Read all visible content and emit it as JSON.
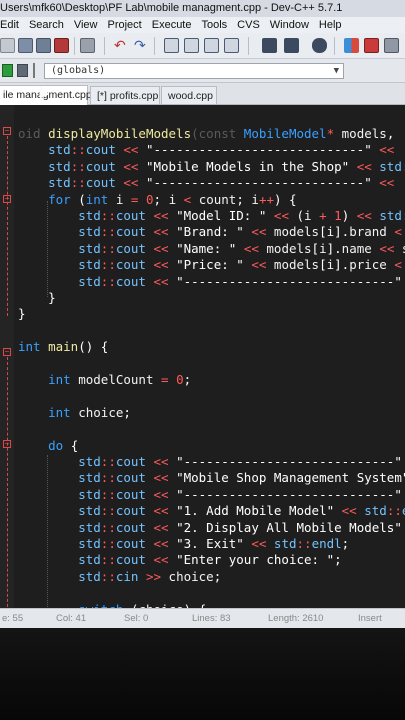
{
  "window": {
    "title": "Users\\mfk60\\Desktop\\PF Lab\\mobile managment.cpp - Dev-C++ 5.7.1"
  },
  "menu": [
    "Edit",
    "Search",
    "View",
    "Project",
    "Execute",
    "Tools",
    "CVS",
    "Window",
    "Help"
  ],
  "toolbar": {
    "icons": [
      "open-icon",
      "save-icon",
      "save-all-icon",
      "close-icon",
      "print-icon",
      "undo-icon",
      "redo-icon",
      "find-icon",
      "replace-icon",
      "find-next-icon",
      "goto-icon",
      "indent-icon",
      "unindent-icon",
      "toggle-comment-icon",
      "grid-icon",
      "window-icon",
      "window-icon-2",
      "window-icon-3"
    ]
  },
  "globals_bar": {
    "value": "(globals)"
  },
  "tabs": [
    {
      "label": "ile managment.cpp",
      "active": true
    },
    {
      "label": "[*] profits.cpp",
      "active": false
    },
    {
      "label": "wood.cpp",
      "active": false
    }
  ],
  "code": {
    "lines": [
      [
        [
          "dim",
          "oid "
        ],
        [
          "fn",
          "displayMobileModels"
        ],
        [
          "dim",
          "("
        ],
        [
          "dim",
          "const "
        ],
        [
          "ty",
          "MobileModel"
        ],
        [
          "op",
          "* "
        ],
        [
          "id",
          "models"
        ],
        [
          "punc",
          ", "
        ]
      ],
      [
        [
          "ns",
          "    std"
        ],
        [
          "op",
          "::"
        ],
        [
          "ns",
          "cout "
        ],
        [
          "op",
          "<< "
        ],
        [
          "str",
          "\"----------------------------\" "
        ],
        [
          "op",
          "<<"
        ]
      ],
      [
        [
          "ns",
          "    std"
        ],
        [
          "op",
          "::"
        ],
        [
          "ns",
          "cout "
        ],
        [
          "op",
          "<< "
        ],
        [
          "str",
          "\"Mobile Models in the Shop\" "
        ],
        [
          "op",
          "<< "
        ],
        [
          "ns",
          "std"
        ],
        [
          "op",
          ":"
        ]
      ],
      [
        [
          "ns",
          "    std"
        ],
        [
          "op",
          "::"
        ],
        [
          "ns",
          "cout "
        ],
        [
          "op",
          "<< "
        ],
        [
          "str",
          "\"----------------------------\" "
        ],
        [
          "op",
          "<<"
        ]
      ],
      [
        [
          "kw",
          "    for "
        ],
        [
          "punc",
          "("
        ],
        [
          "kw",
          "int "
        ],
        [
          "id",
          "i "
        ],
        [
          "op",
          "= "
        ],
        [
          "num",
          "0"
        ],
        [
          "punc",
          "; "
        ],
        [
          "id",
          "i "
        ],
        [
          "op",
          "< "
        ],
        [
          "id",
          "count"
        ],
        [
          "punc",
          "; "
        ],
        [
          "id",
          "i"
        ],
        [
          "op",
          "++"
        ],
        [
          "punc",
          ") {"
        ]
      ],
      [
        [
          "ns",
          "        std"
        ],
        [
          "op",
          "::"
        ],
        [
          "ns",
          "cout "
        ],
        [
          "op",
          "<< "
        ],
        [
          "str",
          "\"Model ID: \" "
        ],
        [
          "op",
          "<< "
        ],
        [
          "punc",
          "("
        ],
        [
          "id",
          "i "
        ],
        [
          "op",
          "+ "
        ],
        [
          "num",
          "1"
        ],
        [
          "punc",
          ") "
        ],
        [
          "op",
          "<< "
        ],
        [
          "ns",
          "std"
        ],
        [
          "op",
          ":"
        ]
      ],
      [
        [
          "ns",
          "        std"
        ],
        [
          "op",
          "::"
        ],
        [
          "ns",
          "cout "
        ],
        [
          "op",
          "<< "
        ],
        [
          "str",
          "\"Brand: \" "
        ],
        [
          "op",
          "<< "
        ],
        [
          "id",
          "models"
        ],
        [
          "punc",
          "["
        ],
        [
          "id",
          "i"
        ],
        [
          "punc",
          "]"
        ],
        [
          "punc",
          "."
        ],
        [
          "id",
          "brand "
        ],
        [
          "op",
          "<"
        ]
      ],
      [
        [
          "ns",
          "        std"
        ],
        [
          "op",
          "::"
        ],
        [
          "ns",
          "cout "
        ],
        [
          "op",
          "<< "
        ],
        [
          "str",
          "\"Name: \" "
        ],
        [
          "op",
          "<< "
        ],
        [
          "id",
          "models"
        ],
        [
          "punc",
          "["
        ],
        [
          "id",
          "i"
        ],
        [
          "punc",
          "]"
        ],
        [
          "punc",
          "."
        ],
        [
          "id",
          "name "
        ],
        [
          "op",
          "<< "
        ],
        [
          "id",
          "s"
        ]
      ],
      [
        [
          "ns",
          "        std"
        ],
        [
          "op",
          "::"
        ],
        [
          "ns",
          "cout "
        ],
        [
          "op",
          "<< "
        ],
        [
          "str",
          "\"Price: \" "
        ],
        [
          "op",
          "<< "
        ],
        [
          "id",
          "models"
        ],
        [
          "punc",
          "["
        ],
        [
          "id",
          "i"
        ],
        [
          "punc",
          "]"
        ],
        [
          "punc",
          "."
        ],
        [
          "id",
          "price "
        ],
        [
          "op",
          "<"
        ]
      ],
      [
        [
          "ns",
          "        std"
        ],
        [
          "op",
          "::"
        ],
        [
          "ns",
          "cout "
        ],
        [
          "op",
          "<< "
        ],
        [
          "str",
          "\"----------------------------\""
        ]
      ],
      [
        [
          "punc",
          "    }"
        ]
      ],
      [
        [
          "punc",
          "}"
        ]
      ],
      [],
      [
        [
          "kw",
          "int "
        ],
        [
          "fn",
          "main"
        ],
        [
          "punc",
          "() {"
        ]
      ],
      [],
      [
        [
          "kw",
          "    int "
        ],
        [
          "id",
          "modelCount "
        ],
        [
          "op",
          "= "
        ],
        [
          "num",
          "0"
        ],
        [
          "punc",
          ";"
        ]
      ],
      [],
      [
        [
          "kw",
          "    int "
        ],
        [
          "id",
          "choice"
        ],
        [
          "punc",
          ";"
        ]
      ],
      [],
      [
        [
          "kw",
          "    do "
        ],
        [
          "punc",
          "{"
        ]
      ],
      [
        [
          "ns",
          "        std"
        ],
        [
          "op",
          "::"
        ],
        [
          "ns",
          "cout "
        ],
        [
          "op",
          "<< "
        ],
        [
          "str",
          "\"----------------------------\" "
        ],
        [
          "op",
          "<"
        ]
      ],
      [
        [
          "ns",
          "        std"
        ],
        [
          "op",
          "::"
        ],
        [
          "ns",
          "cout "
        ],
        [
          "op",
          "<< "
        ],
        [
          "str",
          "\"Mobile Shop Management System\" "
        ],
        [
          "op",
          "<"
        ]
      ],
      [
        [
          "ns",
          "        std"
        ],
        [
          "op",
          "::"
        ],
        [
          "ns",
          "cout "
        ],
        [
          "op",
          "<< "
        ],
        [
          "str",
          "\"----------------------------\" "
        ],
        [
          "op",
          "<"
        ]
      ],
      [
        [
          "ns",
          "        std"
        ],
        [
          "op",
          "::"
        ],
        [
          "ns",
          "cout "
        ],
        [
          "op",
          "<< "
        ],
        [
          "str",
          "\"1. Add Mobile Model\" "
        ],
        [
          "op",
          "<< "
        ],
        [
          "ns",
          "std"
        ],
        [
          "op",
          "::"
        ],
        [
          "ns",
          "end"
        ]
      ],
      [
        [
          "ns",
          "        std"
        ],
        [
          "op",
          "::"
        ],
        [
          "ns",
          "cout "
        ],
        [
          "op",
          "<< "
        ],
        [
          "str",
          "\"2. Display All Mobile Models\" "
        ],
        [
          "op",
          "<<"
        ]
      ],
      [
        [
          "ns",
          "        std"
        ],
        [
          "op",
          "::"
        ],
        [
          "ns",
          "cout "
        ],
        [
          "op",
          "<< "
        ],
        [
          "str",
          "\"3. Exit\" "
        ],
        [
          "op",
          "<< "
        ],
        [
          "ns",
          "std"
        ],
        [
          "op",
          "::"
        ],
        [
          "ns",
          "endl"
        ],
        [
          "punc",
          ";"
        ]
      ],
      [
        [
          "ns",
          "        std"
        ],
        [
          "op",
          "::"
        ],
        [
          "ns",
          "cout "
        ],
        [
          "op",
          "<< "
        ],
        [
          "str",
          "\"Enter your choice: \""
        ],
        [
          "punc",
          ";"
        ]
      ],
      [
        [
          "ns",
          "        std"
        ],
        [
          "op",
          "::"
        ],
        [
          "ns",
          "cin "
        ],
        [
          "op",
          ">> "
        ],
        [
          "id",
          "choice"
        ],
        [
          "punc",
          ";"
        ]
      ],
      [],
      [
        [
          "kw",
          "        switch "
        ],
        [
          "punc",
          "("
        ],
        [
          "id",
          "choice"
        ],
        [
          "punc",
          ") {"
        ]
      ]
    ]
  },
  "status": {
    "line": "e: 55",
    "col": "Col: 41",
    "sel": "Sel: 0",
    "lines": "Lines: 83",
    "length": "Length: 2610",
    "mode": "Insert"
  }
}
